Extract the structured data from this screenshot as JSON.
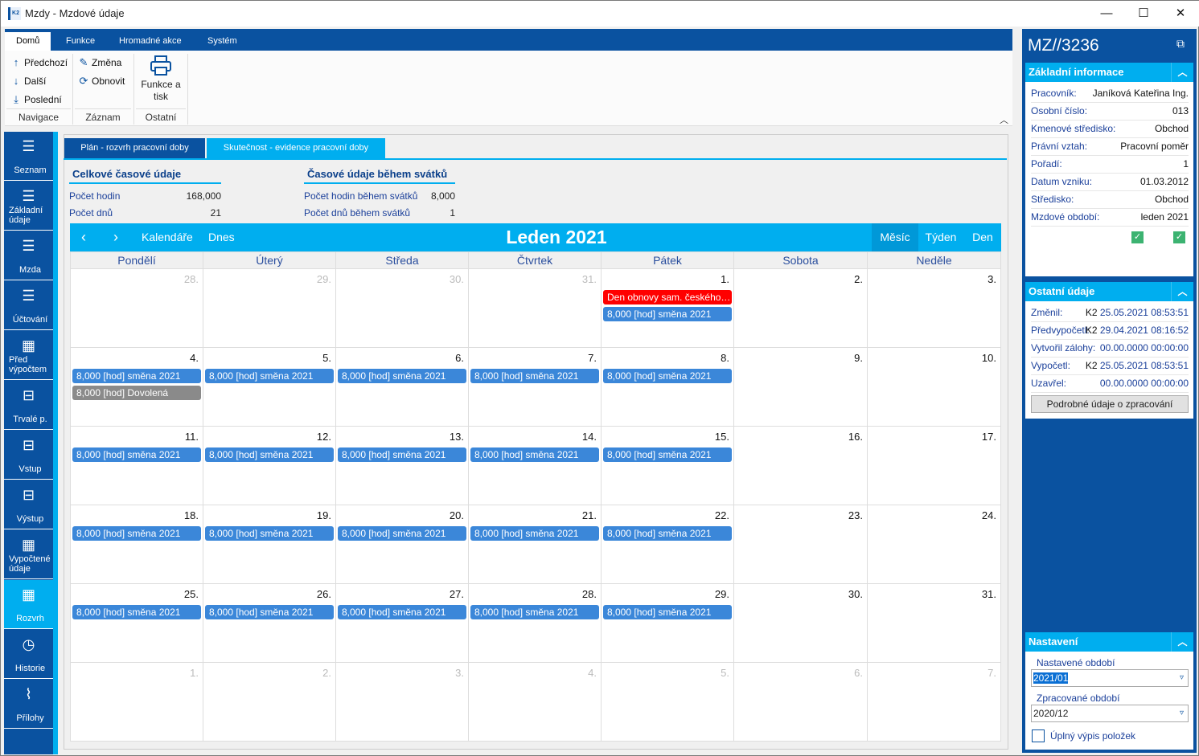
{
  "window": {
    "title": "Mzdy - Mzdové údaje",
    "logo": "K2",
    "minimize": "—",
    "maximize": "☐",
    "close": "✕"
  },
  "ribbon": {
    "tabs": [
      "Domů",
      "Funkce",
      "Hromadné akce",
      "Systém"
    ],
    "nav": {
      "prev": "Předchozí",
      "next": "Další",
      "last": "Poslední",
      "label": "Navigace"
    },
    "record": {
      "change": "Změna",
      "refresh": "Obnovit",
      "label": "Záznam"
    },
    "other": {
      "print": "Funkce a tisk",
      "label": "Ostatní"
    }
  },
  "sidebar": {
    "items": [
      {
        "label": "Seznam",
        "icon": "list-icon"
      },
      {
        "label": "Základní údaje",
        "icon": "bullet-list-icon"
      },
      {
        "label": "Mzda",
        "icon": "bullet-list-icon"
      },
      {
        "label": "Účtování",
        "icon": "bullet-list-icon"
      },
      {
        "label": "Před výpočtem",
        "icon": "calculator-icon"
      },
      {
        "label": "Trvalé p.",
        "icon": "archive-icon"
      },
      {
        "label": "Vstup",
        "icon": "archive-icon"
      },
      {
        "label": "Výstup",
        "icon": "archive-icon"
      },
      {
        "label": "Vypočtené údaje",
        "icon": "calculator-icon"
      },
      {
        "label": "Rozvrh",
        "icon": "calendar-icon",
        "selected": true
      },
      {
        "label": "Historie",
        "icon": "clock-icon"
      },
      {
        "label": "Přílohy",
        "icon": "paperclip-icon"
      }
    ]
  },
  "content": {
    "tabs": [
      "Plán - rozvrh pracovní doby",
      "Skutečnost - evidence pracovní doby"
    ],
    "total": {
      "title": "Celkové časové údaje",
      "hours_label": "Počet hodin",
      "hours": "168,000",
      "days_label": "Počet dnů",
      "days": "21"
    },
    "holiday": {
      "title": "Časové údaje během svátků",
      "hours_label": "Počet hodin během svátků",
      "hours": "8,000",
      "days_label": "Počet dnů během svátků",
      "days": "1"
    }
  },
  "calendar": {
    "calendars": "Kalendáře",
    "today": "Dnes",
    "title": "Leden 2021",
    "views": [
      "Měsíc",
      "Týden",
      "Den"
    ],
    "active_view": "Měsíc",
    "weekdays": [
      "Pondělí",
      "Úterý",
      "Středa",
      "Čtvrtek",
      "Pátek",
      "Sobota",
      "Neděle"
    ],
    "colors": {
      "shift": "#3b87d9",
      "holiday": "#ff0000",
      "vacation": "#8a8a8a"
    },
    "weeks": [
      [
        {
          "n": "28.",
          "om": true
        },
        {
          "n": "29.",
          "om": true
        },
        {
          "n": "30.",
          "om": true
        },
        {
          "n": "31.",
          "om": true
        },
        {
          "n": "1.",
          "ev": [
            {
              "t": "Den obnovy sam. českého státu",
              "c": "holiday"
            },
            {
              "t": "8,000 [hod] směna 2021",
              "c": "shift"
            }
          ]
        },
        {
          "n": "2."
        },
        {
          "n": "3."
        }
      ],
      [
        {
          "n": "4.",
          "ev": [
            {
              "t": "8,000 [hod] směna 2021",
              "c": "shift"
            },
            {
              "t": "8,000 [hod] Dovolená",
              "c": "vacation"
            }
          ]
        },
        {
          "n": "5.",
          "ev": [
            {
              "t": "8,000 [hod] směna 2021",
              "c": "shift"
            }
          ]
        },
        {
          "n": "6.",
          "ev": [
            {
              "t": "8,000 [hod] směna 2021",
              "c": "shift"
            }
          ]
        },
        {
          "n": "7.",
          "ev": [
            {
              "t": "8,000 [hod] směna 2021",
              "c": "shift"
            }
          ]
        },
        {
          "n": "8.",
          "ev": [
            {
              "t": "8,000 [hod] směna 2021",
              "c": "shift"
            }
          ]
        },
        {
          "n": "9."
        },
        {
          "n": "10."
        }
      ],
      [
        {
          "n": "11.",
          "ev": [
            {
              "t": "8,000 [hod] směna 2021",
              "c": "shift"
            }
          ]
        },
        {
          "n": "12.",
          "ev": [
            {
              "t": "8,000 [hod] směna 2021",
              "c": "shift"
            }
          ]
        },
        {
          "n": "13.",
          "ev": [
            {
              "t": "8,000 [hod] směna 2021",
              "c": "shift"
            }
          ]
        },
        {
          "n": "14.",
          "ev": [
            {
              "t": "8,000 [hod] směna 2021",
              "c": "shift"
            }
          ]
        },
        {
          "n": "15.",
          "ev": [
            {
              "t": "8,000 [hod] směna 2021",
              "c": "shift"
            }
          ]
        },
        {
          "n": "16."
        },
        {
          "n": "17."
        }
      ],
      [
        {
          "n": "18.",
          "ev": [
            {
              "t": "8,000 [hod] směna 2021",
              "c": "shift"
            }
          ]
        },
        {
          "n": "19.",
          "ev": [
            {
              "t": "8,000 [hod] směna 2021",
              "c": "shift"
            }
          ]
        },
        {
          "n": "20.",
          "ev": [
            {
              "t": "8,000 [hod] směna 2021",
              "c": "shift"
            }
          ]
        },
        {
          "n": "21.",
          "ev": [
            {
              "t": "8,000 [hod] směna 2021",
              "c": "shift"
            }
          ]
        },
        {
          "n": "22.",
          "ev": [
            {
              "t": "8,000 [hod] směna 2021",
              "c": "shift"
            }
          ]
        },
        {
          "n": "23."
        },
        {
          "n": "24."
        }
      ],
      [
        {
          "n": "25.",
          "ev": [
            {
              "t": "8,000 [hod] směna 2021",
              "c": "shift"
            }
          ]
        },
        {
          "n": "26.",
          "ev": [
            {
              "t": "8,000 [hod] směna 2021",
              "c": "shift"
            }
          ]
        },
        {
          "n": "27.",
          "ev": [
            {
              "t": "8,000 [hod] směna 2021",
              "c": "shift"
            }
          ]
        },
        {
          "n": "28.",
          "ev": [
            {
              "t": "8,000 [hod] směna 2021",
              "c": "shift"
            }
          ]
        },
        {
          "n": "29.",
          "ev": [
            {
              "t": "8,000 [hod] směna 2021",
              "c": "shift"
            }
          ]
        },
        {
          "n": "30."
        },
        {
          "n": "31."
        }
      ],
      [
        {
          "n": "1.",
          "om": true
        },
        {
          "n": "2.",
          "om": true
        },
        {
          "n": "3.",
          "om": true
        },
        {
          "n": "4.",
          "om": true
        },
        {
          "n": "5.",
          "om": true
        },
        {
          "n": "6.",
          "om": true
        },
        {
          "n": "7.",
          "om": true
        }
      ]
    ]
  },
  "panel": {
    "title": "MZ//3236",
    "basic": {
      "title": "Základní informace",
      "rows": [
        {
          "k": "Pracovník:",
          "v": "Janíková Kateřina Ing."
        },
        {
          "k": "Osobní číslo:",
          "v": "013"
        },
        {
          "k": "Kmenové středisko:",
          "v": "Obchod"
        },
        {
          "k": "Právní vztah:",
          "v": "Pracovní poměr"
        },
        {
          "k": "Pořadí:",
          "v": "1"
        },
        {
          "k": "Datum vzniku:",
          "v": "01.03.2012"
        },
        {
          "k": "Středisko:",
          "v": "Obchod"
        },
        {
          "k": "Mzdové období:",
          "v": "leden 2021"
        }
      ],
      "checks": [
        true,
        true
      ]
    },
    "other": {
      "title": "Ostatní údaje",
      "rows": [
        {
          "k": "Změnil:",
          "u": "K2",
          "v": "25.05.2021 08:53:51"
        },
        {
          "k": "Předvypočetl:",
          "u": "K2",
          "v": "29.04.2021 08:16:52"
        },
        {
          "k": "Vytvořil zálohy:",
          "u": "",
          "v": "00.00.0000 00:00:00"
        },
        {
          "k": "Vypočetl:",
          "u": "K2",
          "v": "25.05.2021 08:53:51"
        },
        {
          "k": "Uzavřel:",
          "u": "",
          "v": "00.00.0000 00:00:00"
        }
      ],
      "button": "Podrobné údaje o zpracování"
    },
    "settings": {
      "title": "Nastavení",
      "set_label": "Nastavené období",
      "set_value": "2021/01",
      "proc_label": "Zpracované období",
      "proc_value": "2020/12",
      "full_label": "Úplný výpis položek",
      "full_checked": false
    }
  }
}
